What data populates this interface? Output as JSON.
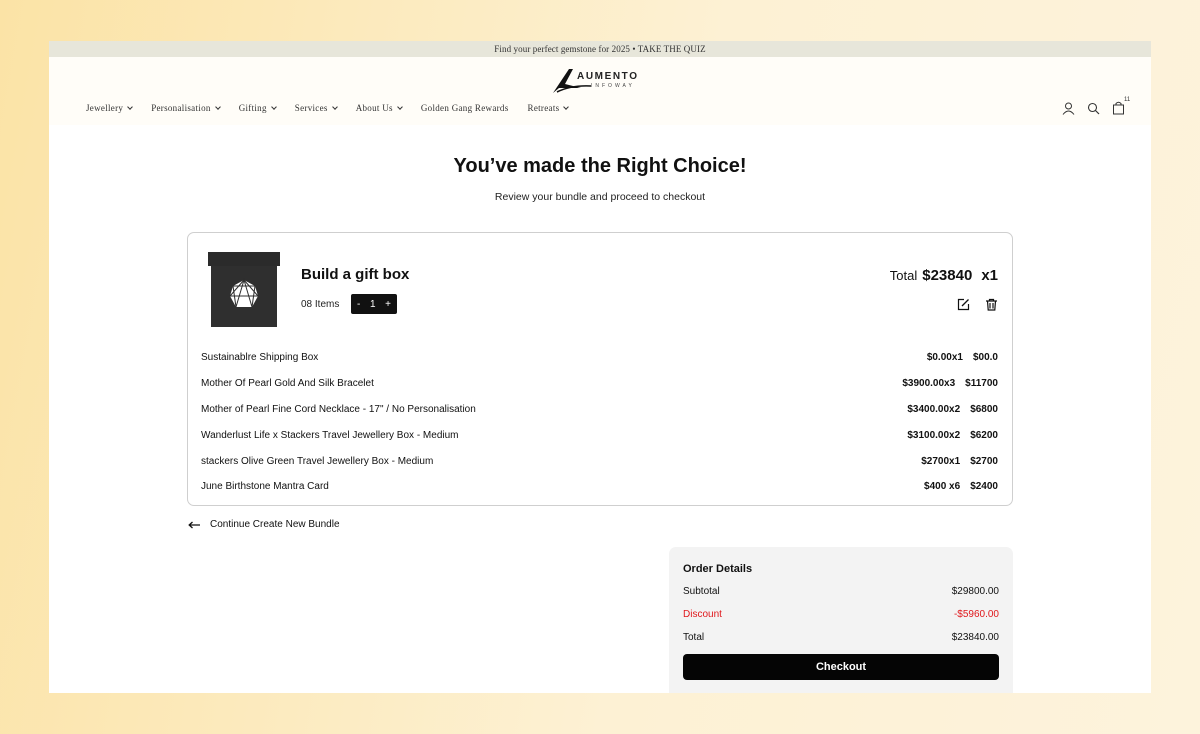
{
  "announcement": "Find your perfect gemstone for 2025 • TAKE THE QUIZ",
  "brand": {
    "name": "AUMENTO",
    "sub": "INFOWAY"
  },
  "nav": [
    {
      "label": "Jewellery",
      "dropdown": true
    },
    {
      "label": "Personalisation",
      "dropdown": true
    },
    {
      "label": "Gifting",
      "dropdown": true
    },
    {
      "label": "Services",
      "dropdown": true
    },
    {
      "label": "About Us",
      "dropdown": true
    },
    {
      "label": "Golden Gang Rewards",
      "dropdown": false
    },
    {
      "label": "Retreats",
      "dropdown": true
    }
  ],
  "header_icons": {
    "account": "user-icon",
    "search": "search-icon",
    "cart": "bag-icon",
    "cart_count": "11"
  },
  "page": {
    "title": "You’ve made the Right Choice!",
    "subtitle": "Review your bundle and proceed to checkout"
  },
  "bundle": {
    "title": "Build a gift box",
    "items_label": "08 Items",
    "stepper": {
      "minus": "-",
      "value": "1",
      "plus": "+"
    },
    "total_label": "Total",
    "total_amount": "$23840",
    "total_qty": "x1",
    "items": [
      {
        "name": "Sustainablre Shipping Box",
        "unit": "$0.00x1",
        "line": "$00.0"
      },
      {
        "name": "Mother Of Pearl Gold And Silk Bracelet",
        "unit": "$3900.00x3",
        "line": "$11700"
      },
      {
        "name": "Mother of Pearl Fine Cord Necklace - 17\" / No Personalisation",
        "unit": "$3400.00x2",
        "line": "$6800"
      },
      {
        "name": "Wanderlust Life x Stackers Travel Jewellery Box - Medium",
        "unit": "$3100.00x2",
        "line": "$6200"
      },
      {
        "name": "stackers Olive Green Travel Jewellery Box - Medium",
        "unit": "$2700x1",
        "line": "$2700"
      },
      {
        "name": "June Birthstone Mantra Card",
        "unit": "$400 x6",
        "line": "$2400"
      }
    ]
  },
  "continue_label": "Continue Create New Bundle",
  "order": {
    "title": "Order Details",
    "subtotal_label": "Subtotal",
    "subtotal": "$29800.00",
    "discount_label": "Discount",
    "discount": "-$5960.00",
    "total_label": "Total",
    "total": "$23840.00",
    "checkout_label": "Checkout"
  },
  "colors": {
    "accent": "#050505",
    "discount": "#e0181c",
    "announce_bg": "#e7e6da"
  }
}
